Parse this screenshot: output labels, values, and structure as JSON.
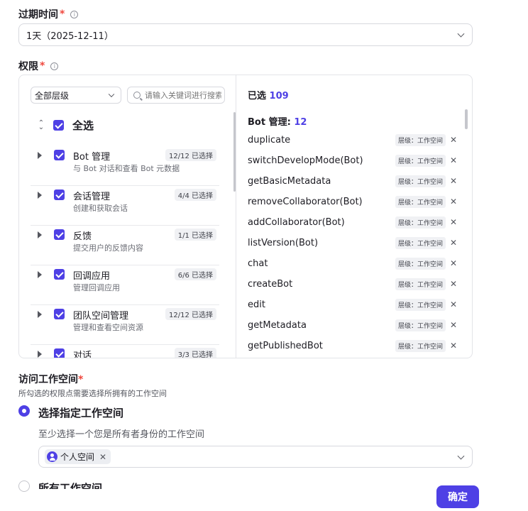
{
  "expiry": {
    "label": "过期时间",
    "value": "1天（2025-12-11）"
  },
  "permissions": {
    "label": "权限",
    "level_filter": "全部层级",
    "search_placeholder": "请输入关键词进行搜索",
    "select_all": "全选",
    "groups": [
      {
        "name": "Bot 管理",
        "desc": "与 Bot 对话和查看 Bot 元数据",
        "count": "12/12 已选择"
      },
      {
        "name": "会话管理",
        "desc": "创建和获取会话",
        "count": "4/4 已选择"
      },
      {
        "name": "反馈",
        "desc": "提交用户的反馈内容",
        "count": "1/1 已选择"
      },
      {
        "name": "回调应用",
        "desc": "管理回调应用",
        "count": "6/6 已选择"
      },
      {
        "name": "团队空间管理",
        "desc": "管理和查看空间资源",
        "count": "12/12 已选择"
      },
      {
        "name": "对话",
        "desc": "",
        "count": "3/3 已选择"
      }
    ],
    "selected_label": "已选",
    "selected_count": "109",
    "section_name": "Bot 管理:",
    "section_count": "12",
    "level_tag": "层级：工作空间",
    "items": [
      "duplicate",
      "switchDevelopMode(Bot)",
      "getBasicMetadata",
      "removeCollaborator(Bot)",
      "addCollaborator(Bot)",
      "listVersion(Bot)",
      "chat",
      "createBot",
      "edit",
      "getMetadata",
      "getPublishedBot"
    ]
  },
  "workspace": {
    "label": "访问工作空间",
    "subtitle": "所勾选的权限点需要选择所拥有的工作空间",
    "option_specific": "选择指定工作空间",
    "hint": "至少选择一个您是所有者身份的工作空间",
    "chip_label": "个人空间",
    "option_all": "所有工作空间"
  },
  "confirm_label": "确定",
  "colors": {
    "accent": "#4e40e5",
    "required": "#f0483e"
  }
}
